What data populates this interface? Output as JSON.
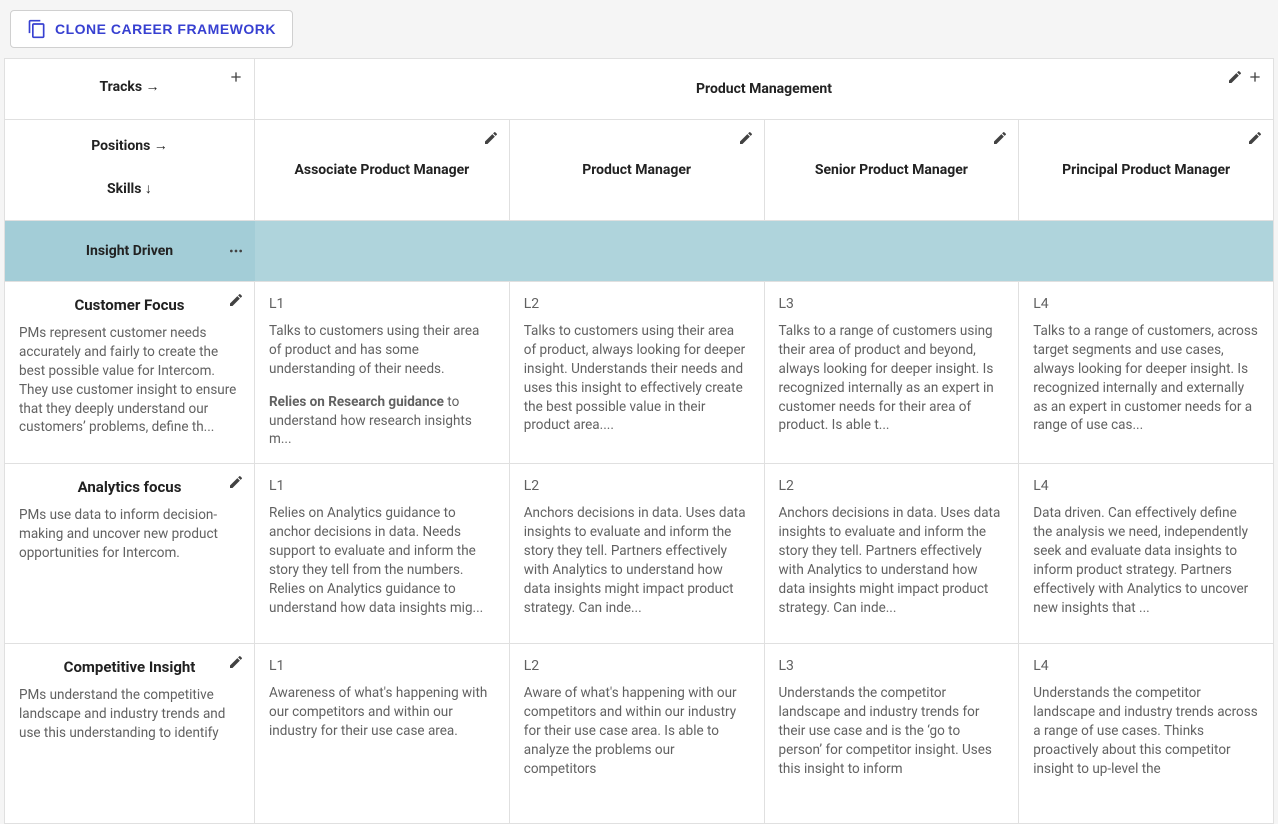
{
  "buttons": {
    "clone": "Clone Career Framework"
  },
  "labels": {
    "tracks": "Tracks →",
    "positions": "Positions →",
    "skills": "Skills ↓"
  },
  "track": "Product Management",
  "positions": [
    "Associate Product Manager",
    "Product Manager",
    "Senior Product Manager",
    "Principal Product Manager"
  ],
  "category": "Insight Driven",
  "skills": [
    {
      "name": "Customer Focus",
      "desc": "PMs represent customer needs accurately and fairly to create the best possible value for Intercom. They use customer insight to ensure that they deeply understand our customers’ problems, define th...",
      "cells": [
        {
          "level": "L1",
          "body": "Talks to customers using their area of product and has some understanding of their needs.",
          "body2_strong": "Relies on Research guidance",
          "body2_rest": " to understand how research insights m..."
        },
        {
          "level": "L2",
          "body": "Talks to customers using their area of product, always looking for deeper insight. Understands their needs and uses this insight to effectively create the best possible value in their product area...."
        },
        {
          "level": "L3",
          "body": "Talks to a range of customers using their area of product and beyond, always looking for deeper insight. Is recognized internally as an expert in customer needs for their area of product. Is able t..."
        },
        {
          "level": "L4",
          "body": "Talks to a range of customers, across target segments and use cases, always looking for deeper insight. Is recognized internally and externally as an expert in customer needs for a range of use cas..."
        }
      ]
    },
    {
      "name": "Analytics focus",
      "desc": "PMs use data to inform decision-making and uncover new product opportunities for Intercom.",
      "cells": [
        {
          "level": "L1",
          "body": "Relies on Analytics guidance to anchor decisions in data. Needs support to evaluate and inform the story they tell from the numbers. Relies on Analytics guidance to understand how data insights mig..."
        },
        {
          "level": "L2",
          "body": "Anchors decisions in data. Uses data insights to evaluate and inform the story they tell. Partners effectively with Analytics to understand how data insights might impact product strategy. Can inde..."
        },
        {
          "level": "L2",
          "body": "Anchors decisions in data. Uses data insights to evaluate and inform the story they tell. Partners effectively with Analytics to understand how data insights might impact product strategy. Can inde..."
        },
        {
          "level": "L4",
          "body": "Data driven. Can effectively define the analysis we need, independently seek and evaluate data insights to inform product strategy. Partners effectively with Analytics to uncover new insights that ..."
        }
      ]
    },
    {
      "name": "Competitive Insight",
      "desc": "PMs understand the competitive landscape and industry trends and use this understanding to identify",
      "cells": [
        {
          "level": "L1",
          "body": "Awareness of what's happening with our competitors and within our industry for their use case area."
        },
        {
          "level": "L2",
          "body": "Aware of what's happening with our competitors and within our industry for their use case area. Is able to analyze the problems our competitors"
        },
        {
          "level": "L3",
          "body": "Understands the competitor landscape and industry trends for their use case and is the ‘go to person’ for competitor insight. Uses this insight to inform"
        },
        {
          "level": "L4",
          "body": "Understands the competitor landscape and industry trends across a range of use cases. Thinks proactively about this competitor insight to up-level the"
        }
      ]
    }
  ]
}
